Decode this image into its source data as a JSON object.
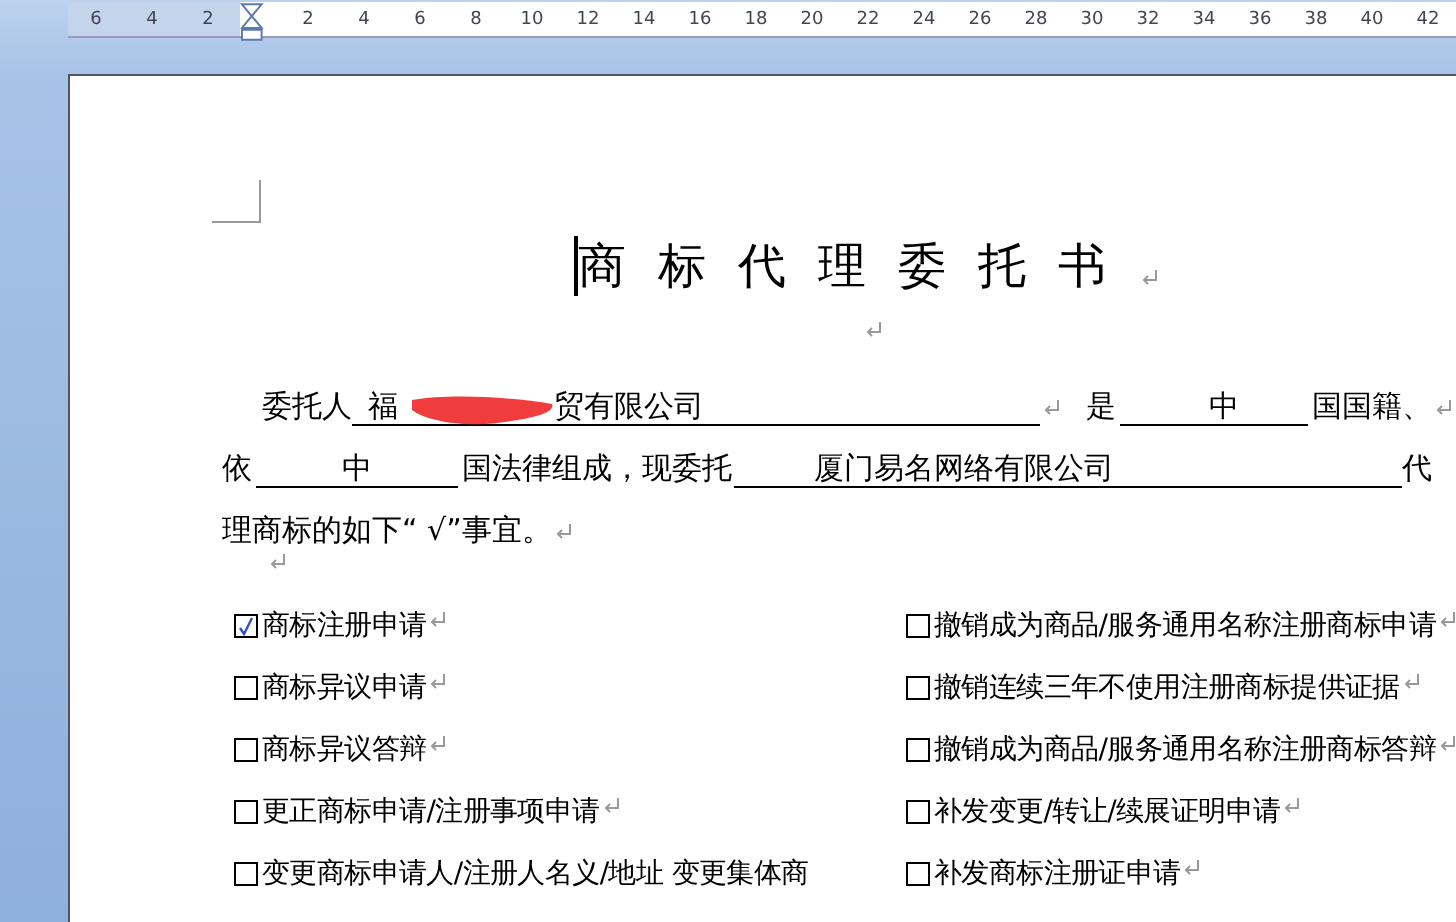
{
  "ruler": {
    "left_ticks": [
      "6",
      "4",
      "2"
    ],
    "ticks": [
      "2",
      "4",
      "6",
      "8",
      "10",
      "12",
      "14",
      "16",
      "18",
      "20",
      "22",
      "24",
      "26",
      "28",
      "30",
      "32",
      "34",
      "36",
      "38",
      "40",
      "42"
    ]
  },
  "document": {
    "title": "商标代理委托书",
    "title_mark": true,
    "principal": {
      "label": "委托人",
      "name_parts": [
        "福",
        "贸有限公司"
      ],
      "redacted": true,
      "mark": true
    },
    "nationality": {
      "label": "是",
      "value": "中",
      "suffix": "国国籍、",
      "mark": true
    },
    "law": {
      "label": "依",
      "value": "中",
      "middle": "国法律组成，现委托",
      "agent": "厦门易名网络有限公司",
      "suffix": "代"
    },
    "closing": {
      "text": "理商标的如下“ √”事宜。",
      "mark": true
    },
    "blank_mark": true,
    "options": [
      {
        "label": "商标注册申请",
        "checked": true,
        "mark": true
      },
      {
        "label": "撤销成为商品/服务通用名称注册商标申请",
        "checked": false,
        "mark": true
      },
      {
        "label": "商标异议申请",
        "checked": false,
        "mark": true
      },
      {
        "label": "撤销连续三年不使用注册商标提供证据",
        "checked": false,
        "mark": true
      },
      {
        "label": "商标异议答辩",
        "checked": false,
        "mark": true
      },
      {
        "label": "撤销成为商品/服务通用名称注册商标答辩",
        "checked": false,
        "mark": true
      },
      {
        "label": "更正商标申请/注册事项申请",
        "checked": false,
        "mark": true
      },
      {
        "label": "补发变更/转让/续展证明申请",
        "checked": false,
        "mark": true
      },
      {
        "label": "变更商标申请人/注册人名义/地址 变更集体商",
        "checked": false,
        "mark": false
      },
      {
        "label": "补发商标注册证申请",
        "checked": false,
        "mark": true
      }
    ]
  }
}
